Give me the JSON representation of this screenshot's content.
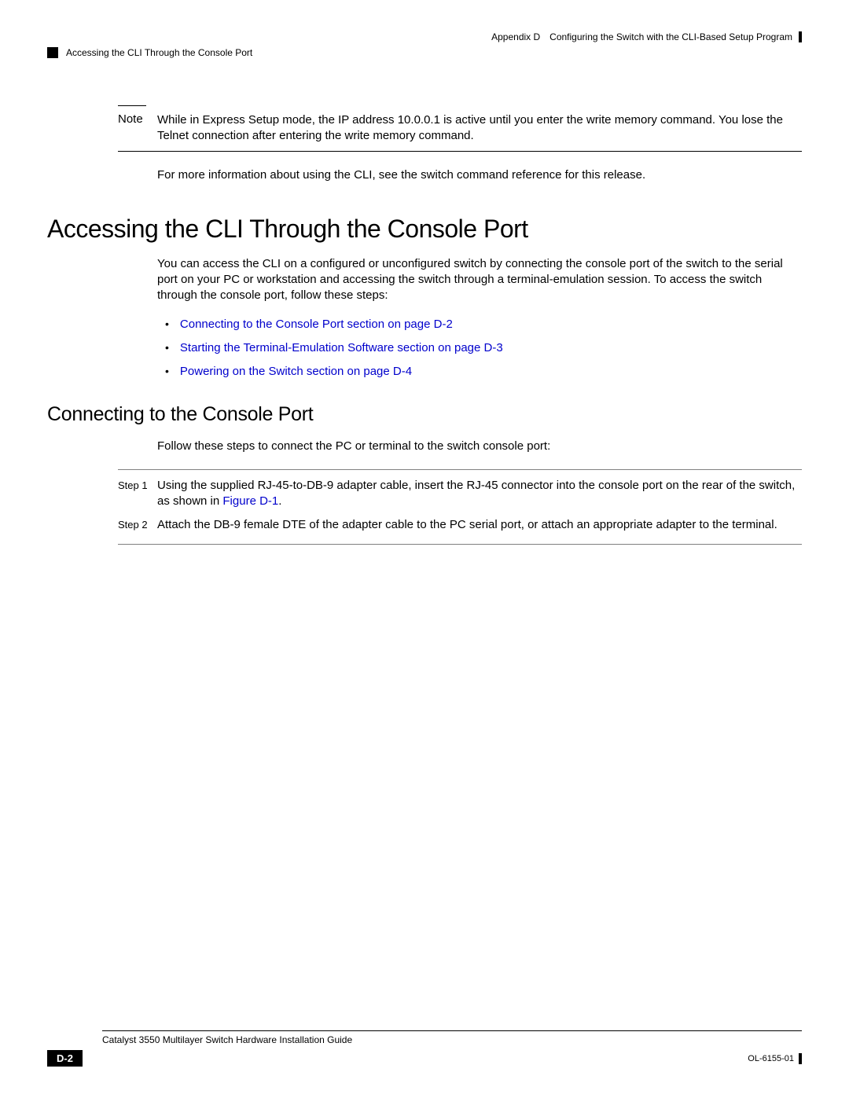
{
  "header": {
    "appendix": "Appendix D",
    "titleTop": "Configuring the Switch with the CLI-Based Setup Program",
    "subheader": "Accessing the CLI Through the Console Port"
  },
  "note": {
    "label": "Note",
    "text": "While in Express Setup mode, the IP address 10.0.0.1 is active until you enter the write memory command. You lose the Telnet connection after entering the write memory command."
  },
  "moreInfo": "For more information about using the CLI, see the switch command reference for this release.",
  "h1": "Accessing the CLI Through the Console Port",
  "intro": "You can access the CLI on a configured or unconfigured switch by connecting the console port of the switch to the serial port on your PC or workstation and accessing the switch through a terminal-emulation session. To access the switch through the console port, follow these steps:",
  "bullets": [
    "Connecting to the Console Port section on page D-2",
    "Starting the Terminal-Emulation Software section on page D-3",
    "Powering on the Switch section on page D-4"
  ],
  "h2": "Connecting to the Console Port",
  "stepIntro": "Follow these steps to connect the PC or terminal to the switch console port:",
  "steps": [
    {
      "label": "Step 1",
      "textBefore": "Using the supplied RJ-45-to-DB-9 adapter cable, insert the RJ-45 connector into the console port on the rear of the switch, as shown in ",
      "link": "Figure D-1",
      "textAfter": "."
    },
    {
      "label": "Step 2",
      "textBefore": "Attach the DB-9 female DTE of the adapter cable to the PC serial port, or attach an appropriate adapter to the terminal.",
      "link": "",
      "textAfter": ""
    }
  ],
  "footer": {
    "guide": "Catalyst 3550 Multilayer Switch Hardware Installation Guide",
    "pageNum": "D-2",
    "docId": "OL-6155-01"
  }
}
